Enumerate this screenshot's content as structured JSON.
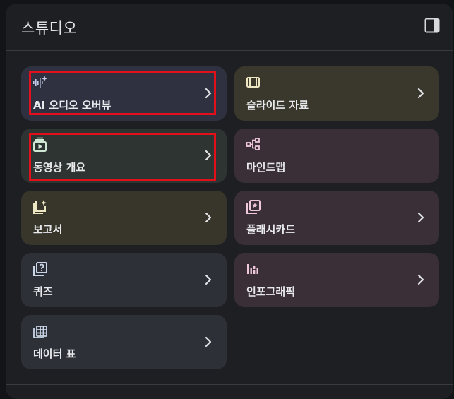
{
  "studio": {
    "title": "스튜디오",
    "toggle_icon": "side-panel-icon"
  },
  "cards": [
    {
      "label": "AI 오디오 오버뷰",
      "icon": "audio-sparkle-icon",
      "bg": "#2f3140",
      "icon_color": "#c5cae9",
      "chevron": true,
      "highlighted": true
    },
    {
      "label": "슬라이드 자료",
      "icon": "slides-icon",
      "bg": "#3a382c",
      "icon_color": "#ece6c2",
      "chevron": true,
      "highlighted": false
    },
    {
      "label": "동영상 개요",
      "icon": "video-overview-icon",
      "bg": "#2e3431",
      "icon_color": "#cfe8d4",
      "chevron": true,
      "highlighted": true
    },
    {
      "label": "마인드맵",
      "icon": "mind-map-icon",
      "bg": "#3a2f36",
      "icon_color": "#f0c8dc",
      "chevron": false,
      "highlighted": false
    },
    {
      "label": "보고서",
      "icon": "report-icon",
      "bg": "#38362b",
      "icon_color": "#ece6c2",
      "chevron": true,
      "highlighted": false
    },
    {
      "label": "플래시카드",
      "icon": "flashcard-icon",
      "bg": "#3a2f36",
      "icon_color": "#f0c8dc",
      "chevron": true,
      "highlighted": false
    },
    {
      "label": "퀴즈",
      "icon": "quiz-icon",
      "bg": "#2e3038",
      "icon_color": "#c9d6e8",
      "chevron": true,
      "highlighted": false
    },
    {
      "label": "인포그래픽",
      "icon": "infographic-icon",
      "bg": "#3a2f36",
      "icon_color": "#f0c8dc",
      "chevron": true,
      "highlighted": false
    },
    {
      "label": "데이터 표",
      "icon": "data-table-icon",
      "bg": "#2e3038",
      "icon_color": "#c9d6e8",
      "chevron": true,
      "highlighted": false
    }
  ],
  "colors": {
    "highlight": "#e2101a",
    "text": "#e8e9ec"
  }
}
